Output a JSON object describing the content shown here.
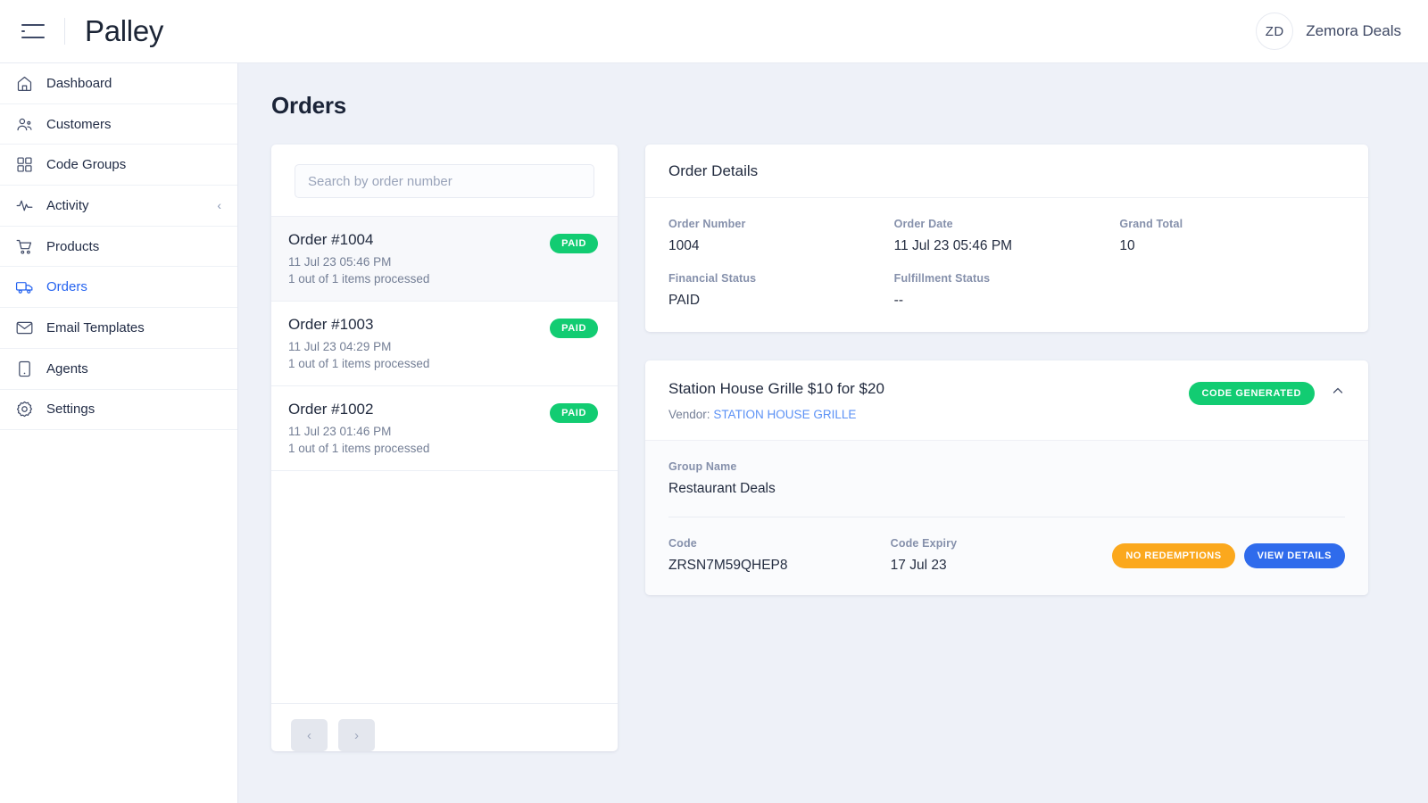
{
  "header": {
    "menu_icon": "hamburger-icon",
    "brand": "Palley",
    "user": {
      "initials": "ZD",
      "name": "Zemora Deals"
    }
  },
  "sidebar": {
    "items": [
      {
        "label": "Dashboard",
        "icon": "home-icon",
        "active": false,
        "chevron": ""
      },
      {
        "label": "Customers",
        "icon": "users-icon",
        "active": false,
        "chevron": ""
      },
      {
        "label": "Code Groups",
        "icon": "grid-icon",
        "active": false,
        "chevron": ""
      },
      {
        "label": "Activity",
        "icon": "pulse-icon",
        "active": false,
        "chevron": "‹"
      },
      {
        "label": "Products",
        "icon": "cart-icon",
        "active": false,
        "chevron": ""
      },
      {
        "label": "Orders",
        "icon": "truck-icon",
        "active": true,
        "chevron": ""
      },
      {
        "label": "Email Templates",
        "icon": "envelope-icon",
        "active": false,
        "chevron": ""
      },
      {
        "label": "Agents",
        "icon": "device-icon",
        "active": false,
        "chevron": ""
      },
      {
        "label": "Settings",
        "icon": "gear-icon",
        "active": false,
        "chevron": ""
      }
    ]
  },
  "page": {
    "title": "Orders"
  },
  "orders_panel": {
    "search": {
      "placeholder": "Search by order number",
      "value": ""
    },
    "rows": [
      {
        "title": "Order #1004",
        "date": "11 Jul 23 05:46 PM",
        "items": "1 out of 1 items processed",
        "status": "PAID",
        "selected": true
      },
      {
        "title": "Order #1003",
        "date": "11 Jul 23 04:29 PM",
        "items": "1 out of 1 items processed",
        "status": "PAID",
        "selected": false
      },
      {
        "title": "Order #1002",
        "date": "11 Jul 23 01:46 PM",
        "items": "1 out of 1 items processed",
        "status": "PAID",
        "selected": false
      }
    ],
    "pagination": {
      "prev": "‹",
      "next": "›"
    }
  },
  "order_details": {
    "title": "Order Details",
    "fields": [
      {
        "label": "Order Number",
        "value": "1004"
      },
      {
        "label": "Order Date",
        "value": "11 Jul 23 05:46 PM"
      },
      {
        "label": "Grand Total",
        "value": "10"
      },
      {
        "label": "Financial Status",
        "value": "PAID"
      },
      {
        "label": "Fulfillment Status",
        "value": "--"
      }
    ]
  },
  "product_card": {
    "title": "Station House Grille $10 for $20",
    "vendor_label": "Vendor:",
    "vendor_name": "STATION HOUSE GRILLE",
    "status_badge": "CODE GENERATED",
    "collapse_icon": "chevron-up-icon",
    "group_name_label": "Group Name",
    "group_name_value": "Restaurant Deals",
    "code_label": "Code",
    "code_value": "ZRSN7M59QHEP8",
    "expiry_label": "Code Expiry",
    "expiry_value": "17 Jul 23",
    "redemptions_button": "NO REDEMPTIONS",
    "details_button": "VIEW DETAILS"
  },
  "colors": {
    "accent_blue": "#2563f0",
    "link_blue": "#5b91f5",
    "green": "#12cc72",
    "orange": "#fba81d",
    "primary_button": "#2f6bec",
    "page_bg": "#eef1f8"
  }
}
